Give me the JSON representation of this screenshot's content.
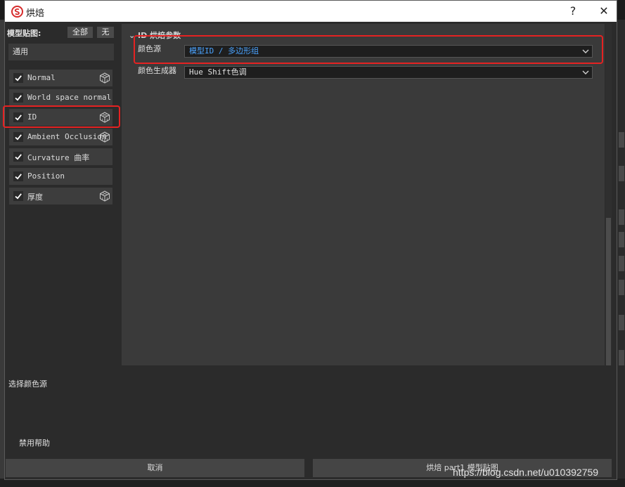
{
  "window": {
    "title": "烘焙",
    "help_glyph": "?",
    "close_glyph": "✕"
  },
  "left": {
    "header": "模型贴图:",
    "all_label": "全部",
    "none_label": "无",
    "preset": "通用",
    "maps": [
      {
        "label": "Normal",
        "checked": true,
        "has_cube_icon": true
      },
      {
        "label": "World space normal",
        "checked": true,
        "has_cube_icon": false
      },
      {
        "label": "ID",
        "checked": true,
        "has_cube_icon": true
      },
      {
        "label": "Ambient Occlusion",
        "checked": true,
        "has_cube_icon": true
      },
      {
        "label": "Curvature 曲率",
        "checked": true,
        "has_cube_icon": false
      },
      {
        "label": "Position",
        "checked": true,
        "has_cube_icon": false
      },
      {
        "label": "厚度",
        "checked": true,
        "has_cube_icon": true
      }
    ]
  },
  "params": {
    "section_title": "ID 烘焙参数",
    "color_source_label": "颜色源",
    "color_source_value": "模型ID / 多边形组",
    "color_generator_label": "颜色生成器",
    "color_generator_value": "Hue Shift色调"
  },
  "hint": "选择颜色源",
  "disable_help": "禁用帮助",
  "footer": {
    "cancel_label": "取消",
    "bake_label": "烘焙 part1 模型贴图"
  },
  "watermark": "https://blog.csdn.net/u010392759",
  "colors": {
    "highlight_red": "#e52222",
    "link_blue": "#4aa3ff",
    "dialog_bg": "#2b2b2b",
    "panel_bg": "#3a3a3a"
  }
}
